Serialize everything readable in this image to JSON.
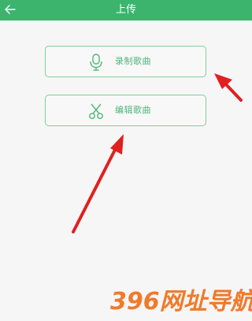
{
  "header": {
    "title": "上传",
    "back_icon": "back-arrow-icon"
  },
  "actions": [
    {
      "label": "录制歌曲",
      "icon": "microphone-icon"
    },
    {
      "label": "编辑歌曲",
      "icon": "scissors-icon"
    }
  ],
  "annotation": {
    "arrow_color": "#e02020"
  },
  "watermark": {
    "text": "396网址导航"
  },
  "colors": {
    "header_bg": "#3cb46e",
    "accent": "#4cb57c",
    "page_bg": "#f6f6f6"
  }
}
